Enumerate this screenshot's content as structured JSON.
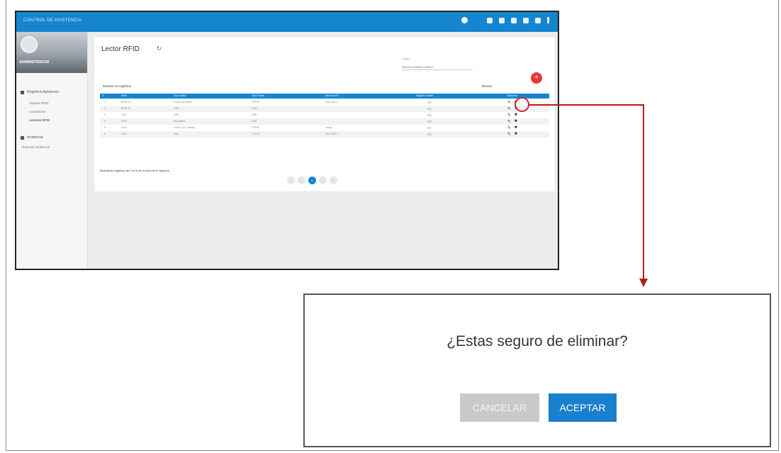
{
  "app": {
    "title": "CONTROL DE ASISTENCIA"
  },
  "profile": {
    "name": "ADMINISTRADOR"
  },
  "sidebar": {
    "items": [
      {
        "label": "Registros Asistencia",
        "subitems": [
          {
            "label": "Tarjetas RFID"
          },
          {
            "label": "Contadores"
          },
          {
            "label": "Lectores RFID"
          }
        ]
      },
      {
        "label": "Incidencia",
        "subitems": [
          {
            "label": "Reportar Incidencia"
          }
        ]
      }
    ]
  },
  "page": {
    "title": "Lector RFID",
    "cargo_label": "Cargo",
    "cargo_value": "SELECCIONAR CARGO",
    "show_entries": "Mostrar 10 registros",
    "search_label": "Buscar:",
    "table": {
      "headers": [
        "#",
        "Serie",
        "Tipo Lector",
        "Tipo Puerto",
        "Dirección IP",
        "Asignar Horario",
        "Opciones"
      ],
      "rows": [
        [
          "1",
          "RFID-01",
          "Lector de tarjeta",
          "TCP/IP",
          "192.168.0.1"
        ],
        [
          "2",
          "RFID-02",
          "USB",
          "USB",
          ""
        ],
        [
          "3",
          "1001",
          "USB",
          "USB",
          ""
        ],
        [
          "4",
          "1002",
          "Biometrico",
          "USB",
          ""
        ],
        [
          "5",
          "1003",
          "Lector Con Teclado",
          "TCP/IP",
          "Lector"
        ],
        [
          "6",
          "1004",
          "USB",
          "TCP/IP",
          "192.168.1.2"
        ]
      ]
    },
    "showing": "Mostrando registros del 1 al 6 de un total de 6 registros",
    "pager": [
      "«",
      "‹",
      "1",
      "›",
      "»"
    ]
  },
  "dialog": {
    "message": "¿Estas seguro de eliminar?",
    "cancel_label": "CANCELAR",
    "accept_label": "ACEPTAR"
  }
}
